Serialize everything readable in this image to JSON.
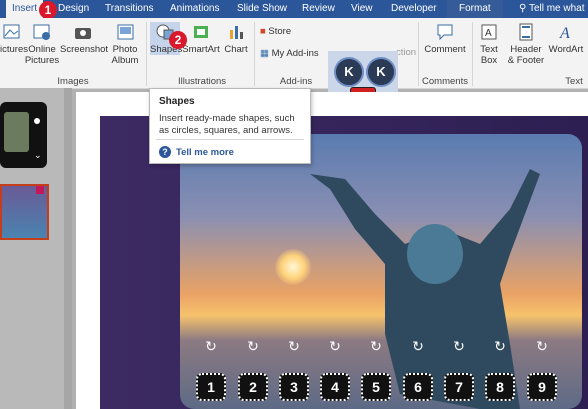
{
  "tabs": [
    "Insert",
    "Design",
    "Transitions",
    "Animations",
    "Slide Show",
    "Review",
    "View",
    "Developer",
    "Format"
  ],
  "tell_me": "Tell me what",
  "ribbon": {
    "pictures": "ictures",
    "online_pictures": "Online Pictures",
    "screenshot": "Screenshot",
    "photo_album": "Photo Album",
    "images_group": "Images",
    "shapes": "Shapes",
    "smartart": "SmartArt",
    "chart": "Chart",
    "illustrations_group": "Illustrations",
    "store": "Store",
    "my_addins": "My Add-ins",
    "addins_group": "Add-ins",
    "action_fragment": "ction",
    "comment": "Comment",
    "comments_group": "Comments",
    "text_box": "Text Box",
    "header_footer": "Header & Footer",
    "wordart": "WordArt",
    "text_group": "Text"
  },
  "badges": [
    "1",
    "2"
  ],
  "tooltip": {
    "title": "Shapes",
    "description": "Insert ready-made shapes, such as circles, squares, and arrows.",
    "help": "Tell me more"
  },
  "addin_icons": [
    "K",
    "K"
  ],
  "numbers": [
    "1",
    "2",
    "3",
    "4",
    "5",
    "6",
    "7",
    "8",
    "9"
  ],
  "colors": {
    "accent": "#2b579a",
    "badge": "#d9182b"
  }
}
